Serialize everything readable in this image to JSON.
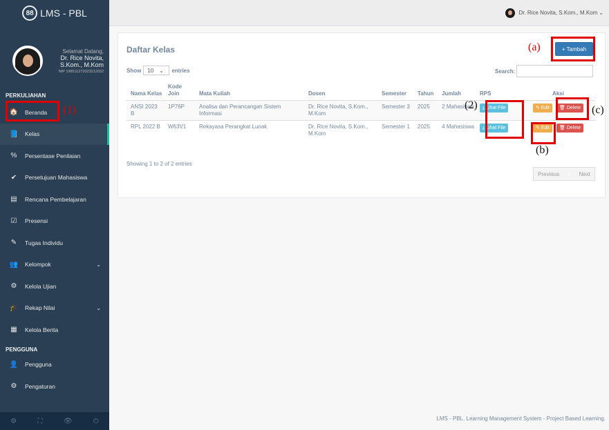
{
  "brand": {
    "logo_text": "88",
    "title": "LMS - PBL"
  },
  "profile": {
    "greeting": "Selamat Datang,",
    "name": "Dr. Rice Novita, S.Kom., M.Kom",
    "nip": "NIP 198511272023212032"
  },
  "sidebar": {
    "section_perkuliahan": "PERKULIAHAN",
    "section_pengguna": "PENGGUNA",
    "items": [
      {
        "label": "Beranda",
        "icon": "home-icon",
        "glyph": "🏠"
      },
      {
        "label": "Kelas",
        "icon": "book-icon",
        "glyph": "📘"
      },
      {
        "label": "Persentase Penilaian",
        "icon": "percent-icon",
        "glyph": "%"
      },
      {
        "label": "Persetujuan Mahasiswa",
        "icon": "check-circle-icon",
        "glyph": "✔"
      },
      {
        "label": "Rencana Pembelajaran",
        "icon": "file-text-icon",
        "glyph": "▤"
      },
      {
        "label": "Presensi",
        "icon": "check-square-icon",
        "glyph": "☑"
      },
      {
        "label": "Tugas Individu",
        "icon": "edit-icon",
        "glyph": "✎"
      },
      {
        "label": "Kelompok",
        "icon": "users-icon",
        "glyph": "👥"
      },
      {
        "label": "Kelola Ujian",
        "icon": "cogs-icon",
        "glyph": "⚙"
      },
      {
        "label": "Rekap Nilai",
        "icon": "graduation-cap-icon",
        "glyph": "🎓"
      },
      {
        "label": "Kelola Berita",
        "icon": "newspaper-icon",
        "glyph": "▦"
      }
    ],
    "pengguna_items": [
      {
        "label": "Pengguna",
        "icon": "user-icon",
        "glyph": "👤"
      },
      {
        "label": "Pengaturan",
        "icon": "gear-icon",
        "glyph": "⚙"
      }
    ],
    "caret": "⌄",
    "footer_icons": [
      "⚙",
      "⛶",
      "👁",
      "⏻"
    ]
  },
  "topbar": {
    "user_name": "Dr. Rice Novita, S.Kom., M.Kom",
    "caret": "⌄"
  },
  "panel": {
    "title": "Daftar Kelas",
    "add_button": "+ Tambah",
    "show_label": "Show",
    "entries_value": "10",
    "entries_caret": "⌄",
    "entries_label": "entries",
    "search_label": "Search:",
    "showing_text": "Showing 1 to 2 of 2 entries",
    "pager": {
      "previous": "Previous",
      "page": "1",
      "next": "Next"
    }
  },
  "table": {
    "headers": [
      "Nama Kelas",
      "Kode Join",
      "Mata Kuliah",
      "Dosen",
      "Semester",
      "Tahun",
      "Jumlah",
      "RPS",
      "Aksi"
    ],
    "rows": [
      {
        "nama": "ANSI 2023 B",
        "kode": "1P76P",
        "matkul": "Analisa dan Perancangan Sistem Informasi",
        "dosen": "Dr. Rice Novita, S.Kom., M.Kom",
        "semester": "Semester 3",
        "tahun": "2025",
        "jumlah": "2 Mahasiswa"
      },
      {
        "nama": "RPL 2022 B",
        "kode": "W63V1",
        "matkul": "Rekayasa Perangkat Lunak",
        "dosen": "Dr. Rice Novita, S.Kom., M.Kom",
        "semester": "Semester 1",
        "tahun": "2025",
        "jumlah": "4 Mahasiswa"
      }
    ],
    "lihat_file": "⤓ Lihat File",
    "edit": "✎ Edit",
    "delete": "🗑 Delete"
  },
  "footer": {
    "text": "LMS - PBL. Learning Management System - Project Based Learning."
  },
  "annotations": {
    "a": "(a)",
    "b": "(b)",
    "c": "(c)",
    "one": "(1)",
    "two": "(2)"
  },
  "colors": {
    "sidebar_bg": "#2a3f54",
    "accent": "#1abb9c",
    "primary": "#337ab7",
    "info": "#5bc0de",
    "warning": "#f0ad4e",
    "danger": "#d9534f",
    "annotation": "#e00000"
  }
}
